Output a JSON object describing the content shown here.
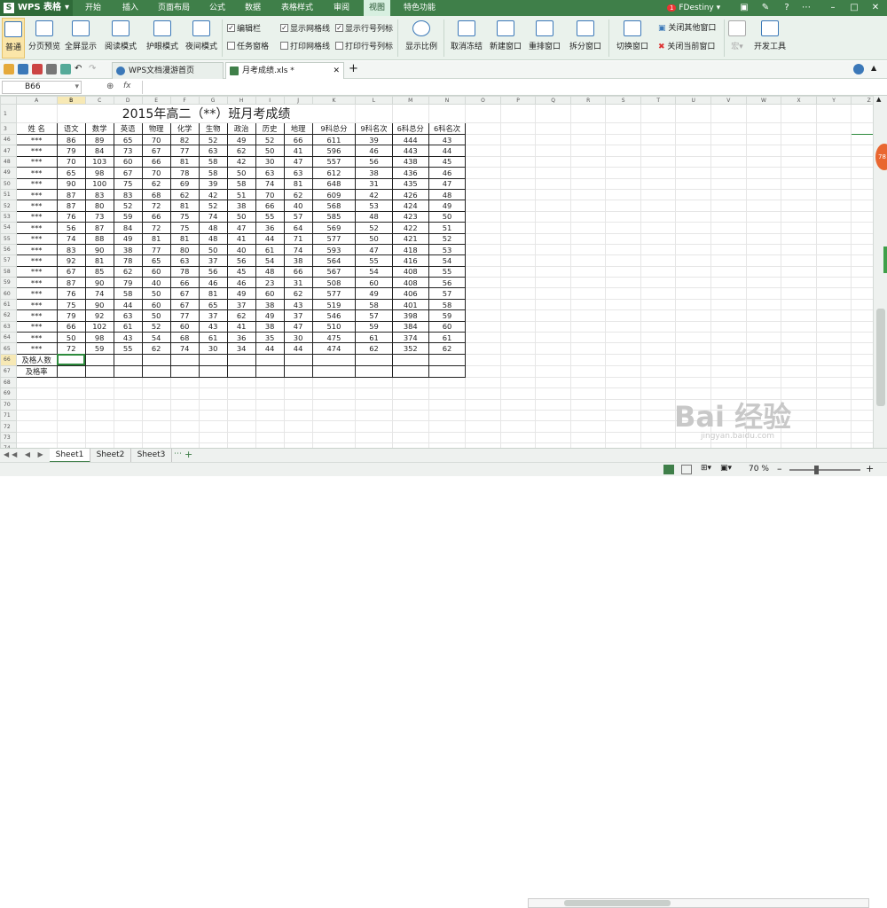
{
  "app": {
    "name": "WPS 表格"
  },
  "menu": [
    "开始",
    "插入",
    "页面布局",
    "公式",
    "数据",
    "表格样式",
    "审阅",
    "视图",
    "特色功能"
  ],
  "active_menu": "视图",
  "user": {
    "name": "FDestiny",
    "notify_count": "1"
  },
  "ribbon": {
    "view_buttons": [
      "普通",
      "分页预览",
      "全屏显示",
      "阅读模式",
      "护眼模式",
      "夜间模式"
    ],
    "checks1": [
      {
        "label": "编辑栏",
        "checked": true
      },
      {
        "label": "任务窗格",
        "checked": false
      }
    ],
    "checks2": [
      {
        "label": "显示网格线",
        "checked": true
      },
      {
        "label": "打印网格线",
        "checked": false
      }
    ],
    "checks3": [
      {
        "label": "显示行号列标",
        "checked": true
      },
      {
        "label": "打印行号列标",
        "checked": false
      }
    ],
    "zoom_button": "显示比例",
    "window_buttons": [
      "取消冻结",
      "新建窗口",
      "重排窗口",
      "拆分窗口"
    ],
    "switch_window": "切换窗口",
    "close_other": "关闭其他窗口",
    "close_current": "关闭当前窗口",
    "dev_tools": "开发工具"
  },
  "doc_tabs": [
    {
      "label": "WPS文档漫游首页"
    },
    {
      "label": "月考成绩.xls *"
    }
  ],
  "formula_bar": {
    "cell_ref": "B66",
    "fx": "fx",
    "value": ""
  },
  "columns": [
    "A",
    "B",
    "C",
    "D",
    "E",
    "F",
    "G",
    "H",
    "I",
    "J",
    "K",
    "L",
    "M",
    "N",
    "O",
    "P",
    "Q",
    "R",
    "S",
    "T",
    "U",
    "V",
    "W",
    "X",
    "Y",
    "Z"
  ],
  "sheet": {
    "title_row": "1",
    "title": "2015年高二（**）班月考成绩",
    "header_row_num": "3",
    "headers": [
      "姓  名",
      "语文",
      "数学",
      "英语",
      "物理",
      "化学",
      "生物",
      "政治",
      "历史",
      "地理",
      "9科总分",
      "9科名次",
      "6科总分",
      "6科名次"
    ],
    "name_mask": "***",
    "rows": [
      {
        "r": "46",
        "v": [
          "86",
          "89",
          "65",
          "70",
          "82",
          "52",
          "49",
          "52",
          "66",
          "611",
          "39",
          "444",
          "43"
        ]
      },
      {
        "r": "47",
        "v": [
          "79",
          "84",
          "73",
          "67",
          "77",
          "63",
          "62",
          "50",
          "41",
          "596",
          "46",
          "443",
          "44"
        ]
      },
      {
        "r": "48",
        "v": [
          "70",
          "103",
          "60",
          "66",
          "81",
          "58",
          "42",
          "30",
          "47",
          "557",
          "56",
          "438",
          "45"
        ]
      },
      {
        "r": "49",
        "v": [
          "65",
          "98",
          "67",
          "70",
          "78",
          "58",
          "50",
          "63",
          "63",
          "612",
          "38",
          "436",
          "46"
        ]
      },
      {
        "r": "50",
        "v": [
          "90",
          "100",
          "75",
          "62",
          "69",
          "39",
          "58",
          "74",
          "81",
          "648",
          "31",
          "435",
          "47"
        ]
      },
      {
        "r": "51",
        "v": [
          "87",
          "83",
          "83",
          "68",
          "62",
          "42",
          "51",
          "70",
          "62",
          "609",
          "42",
          "426",
          "48"
        ]
      },
      {
        "r": "52",
        "v": [
          "87",
          "80",
          "52",
          "72",
          "81",
          "52",
          "38",
          "66",
          "40",
          "568",
          "53",
          "424",
          "49"
        ]
      },
      {
        "r": "53",
        "v": [
          "76",
          "73",
          "59",
          "66",
          "75",
          "74",
          "50",
          "55",
          "57",
          "585",
          "48",
          "423",
          "50"
        ]
      },
      {
        "r": "54",
        "v": [
          "56",
          "87",
          "84",
          "72",
          "75",
          "48",
          "47",
          "36",
          "64",
          "569",
          "52",
          "422",
          "51"
        ]
      },
      {
        "r": "55",
        "v": [
          "74",
          "88",
          "49",
          "81",
          "81",
          "48",
          "41",
          "44",
          "71",
          "577",
          "50",
          "421",
          "52"
        ]
      },
      {
        "r": "56",
        "v": [
          "83",
          "90",
          "38",
          "77",
          "80",
          "50",
          "40",
          "61",
          "74",
          "593",
          "47",
          "418",
          "53"
        ]
      },
      {
        "r": "57",
        "v": [
          "92",
          "81",
          "78",
          "65",
          "63",
          "37",
          "56",
          "54",
          "38",
          "564",
          "55",
          "416",
          "54"
        ]
      },
      {
        "r": "58",
        "v": [
          "67",
          "85",
          "62",
          "60",
          "78",
          "56",
          "45",
          "48",
          "66",
          "567",
          "54",
          "408",
          "55"
        ]
      },
      {
        "r": "59",
        "v": [
          "87",
          "90",
          "79",
          "40",
          "66",
          "46",
          "46",
          "23",
          "31",
          "508",
          "60",
          "408",
          "56"
        ]
      },
      {
        "r": "60",
        "v": [
          "76",
          "74",
          "58",
          "50",
          "67",
          "81",
          "49",
          "60",
          "62",
          "577",
          "49",
          "406",
          "57"
        ]
      },
      {
        "r": "61",
        "v": [
          "75",
          "90",
          "44",
          "60",
          "67",
          "65",
          "37",
          "38",
          "43",
          "519",
          "58",
          "401",
          "58"
        ]
      },
      {
        "r": "62",
        "v": [
          "79",
          "92",
          "63",
          "50",
          "77",
          "37",
          "62",
          "49",
          "37",
          "546",
          "57",
          "398",
          "59"
        ]
      },
      {
        "r": "63",
        "v": [
          "66",
          "102",
          "61",
          "52",
          "60",
          "43",
          "41",
          "38",
          "47",
          "510",
          "59",
          "384",
          "60"
        ]
      },
      {
        "r": "64",
        "v": [
          "50",
          "98",
          "43",
          "54",
          "68",
          "61",
          "36",
          "35",
          "30",
          "475",
          "61",
          "374",
          "61"
        ]
      },
      {
        "r": "65",
        "v": [
          "72",
          "59",
          "55",
          "62",
          "74",
          "30",
          "34",
          "44",
          "44",
          "474",
          "62",
          "352",
          "62"
        ]
      }
    ],
    "footer_rows": [
      {
        "r": "66",
        "label": "及格人数"
      },
      {
        "r": "67",
        "label": "及格率"
      }
    ],
    "empty_rows": [
      "68",
      "69",
      "70",
      "71",
      "72",
      "73",
      "74",
      "75"
    ]
  },
  "sheet_tabs": [
    "Sheet1",
    "Sheet2",
    "Sheet3"
  ],
  "zoom": "70 %",
  "watermark": {
    "main": "Bai 经验",
    "sub": "jingyan.baidu.com"
  },
  "floating_badge": "78"
}
